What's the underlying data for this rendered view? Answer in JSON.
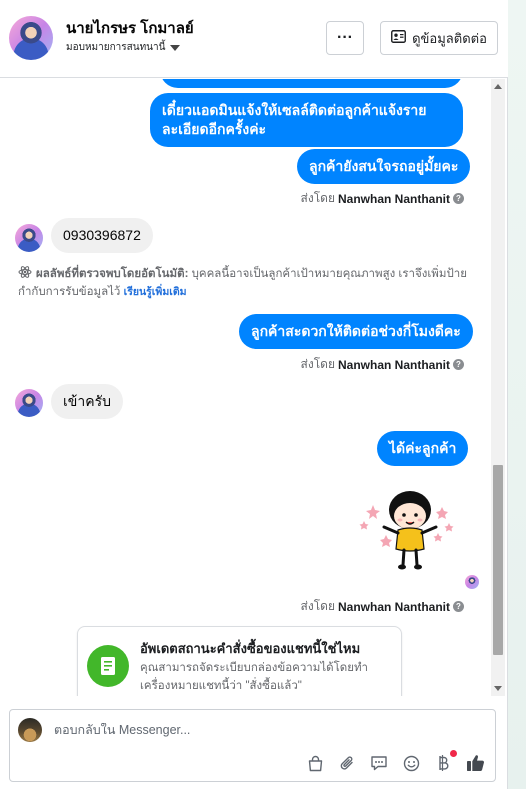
{
  "header": {
    "contact_name": "นายไกรษร โกมาลย์",
    "assignment_label": "มอบหมายการสนทนานี้",
    "more_label": "···",
    "contact_info_label": "ดูข้อมูลติดต่อ"
  },
  "messages": {
    "out_partial": "",
    "out_1": "เดี๋ยวแอดมินแจ้งให้เซลล์ติดต่อลูกค้าแจ้งรายละเอียดอีกครั้งค่ะ",
    "out_2": "ลูกค้ายังสนใจรถอยู่มั้ยคะ",
    "sent_by_1_prefix": "ส่งโดย",
    "sent_by_1_name": "Nanwhan Nanthanit",
    "in_1": "0930396872",
    "auto_title": "ผลลัพธ์ที่ตรวจพบโดยอัตโนมัติ:",
    "auto_body": "บุคคลนี้อาจเป็นลูกค้าเป้าหมายคุณภาพสูง เราจึงเพิ่มป้ายกำกับการรับข้อมูลไว้",
    "auto_link": "เรียนรู้เพิ่มเติม",
    "out_3": "ลูกค้าสะดวกให้ติดต่อช่วงกี่โมงดีคะ",
    "sent_by_2_prefix": "ส่งโดย",
    "sent_by_2_name": "Nanwhan Nanthanit",
    "in_2": "เข้าครับ",
    "out_4": "ได้ค่ะลูกค้า",
    "sent_by_3_prefix": "ส่งโดย",
    "sent_by_3_name": "Nanwhan Nanthanit"
  },
  "card": {
    "title": "อัพเดตสถานะคำสั่งซื้อของแชทนี้ใช่ไหม",
    "description": "คุณสามารถจัดระเบียบกล่องข้อความได้โดยทำเครื่องหมายแชทนี้ว่า \"สั่งซื้อแล้ว\""
  },
  "composer": {
    "placeholder": "ตอบกลับใน Messenger..."
  },
  "toolbar": {
    "icons": [
      "shopping-bag-icon",
      "paperclip-icon",
      "saved-reply-icon",
      "emoji-icon",
      "baht-icon",
      "thumbs-up-icon"
    ]
  },
  "colors": {
    "accent_blue": "#0084ff",
    "bubble_gray": "#f0f0f0",
    "card_green": "#42b72a",
    "link_blue": "#216fdb",
    "notification_red": "#f02849"
  }
}
